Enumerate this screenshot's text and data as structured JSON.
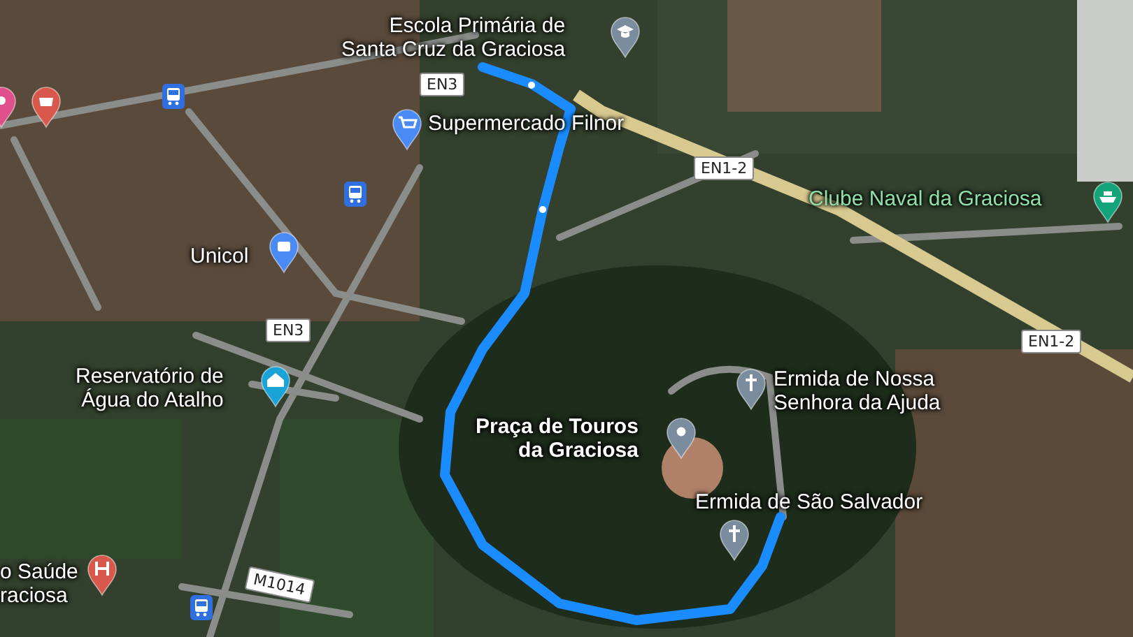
{
  "places": [
    {
      "lines": [
        "Escola Primária de",
        "Santa Cruz da Graciosa"
      ],
      "kind": "school",
      "color": "#7a8c9e"
    },
    {
      "lines": [
        "Supermercado Filnor"
      ],
      "kind": "shop",
      "color": "#4a8af4"
    },
    {
      "lines": [
        "Unicol"
      ],
      "kind": "store",
      "color": "#4a8af4"
    },
    {
      "lines": [
        "Reservatório de",
        "Água do Atalho"
      ],
      "kind": "water",
      "color": "#1aa3d6"
    },
    {
      "lines": [
        "Clube Naval da Graciosa"
      ],
      "kind": "boat",
      "color": "#13a37a"
    },
    {
      "lines": [
        "Praça de Touros",
        "da Graciosa"
      ],
      "kind": "landmark",
      "color": "#7a8c9e"
    },
    {
      "lines": [
        "Ermida de Nossa",
        "Senhora da Ajuda"
      ],
      "kind": "church",
      "color": "#7a8c9e"
    },
    {
      "lines": [
        "Ermida de São Salvador"
      ],
      "kind": "church",
      "color": "#7a8c9e"
    },
    {
      "lines": [
        "o Saúde",
        "raciosa"
      ],
      "kind": "hospital",
      "color": "#d8594c"
    }
  ],
  "markers": [
    {
      "kind": "pharmacy",
      "color": "#d8594c"
    },
    {
      "kind": "partial",
      "color": "#e0508a"
    },
    {
      "kind": "bus",
      "color": "#2f6fe0"
    },
    {
      "kind": "bus",
      "color": "#2f6fe0"
    },
    {
      "kind": "bus",
      "color": "#2f6fe0"
    }
  ],
  "shields": [
    {
      "text": "EN3"
    },
    {
      "text": "EN1-2"
    },
    {
      "text": "EN1-2"
    },
    {
      "text": "EN3"
    },
    {
      "text": "M1014"
    }
  ]
}
